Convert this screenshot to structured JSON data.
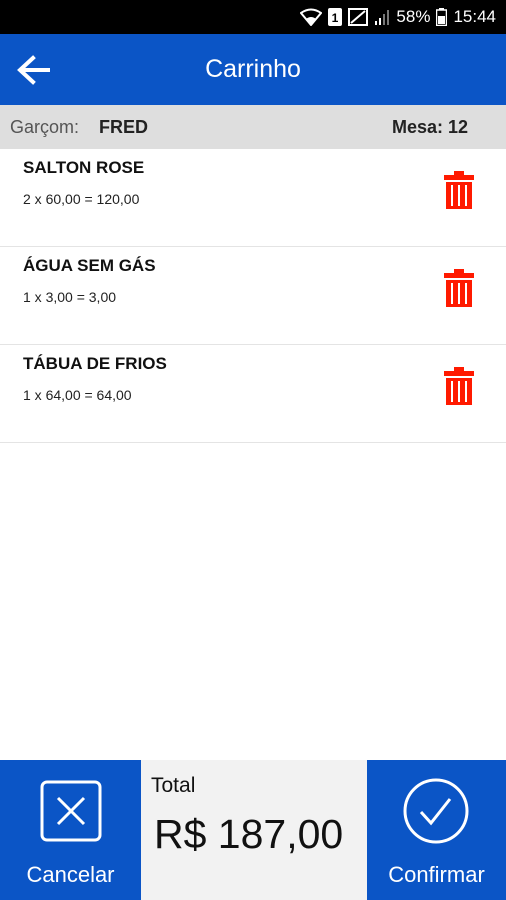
{
  "status_bar": {
    "battery": "58%",
    "time": "15:44",
    "sim_badge": "1"
  },
  "app_bar": {
    "title": "Carrinho",
    "back_icon": "arrow-left-icon"
  },
  "info_bar": {
    "waiter_label": "Garçom:",
    "waiter_name": "FRED",
    "table_label": "Mesa: 12"
  },
  "cart_items": [
    {
      "name": "SALTON ROSE",
      "calc": "2 x 60,00 = 120,00"
    },
    {
      "name": "ÁGUA SEM GÁS",
      "calc": "1 x 3,00 = 3,00"
    },
    {
      "name": "TÁBUA DE FRIOS",
      "calc": "1 x 64,00 = 64,00"
    }
  ],
  "footer": {
    "cancel_label": "Cancelar",
    "total_label": "Total",
    "total_value": "R$ 187,00",
    "confirm_label": "Confirmar"
  },
  "colors": {
    "primary": "#0b55c6",
    "delete": "#ff1a00",
    "info_bar": "#dedede"
  }
}
